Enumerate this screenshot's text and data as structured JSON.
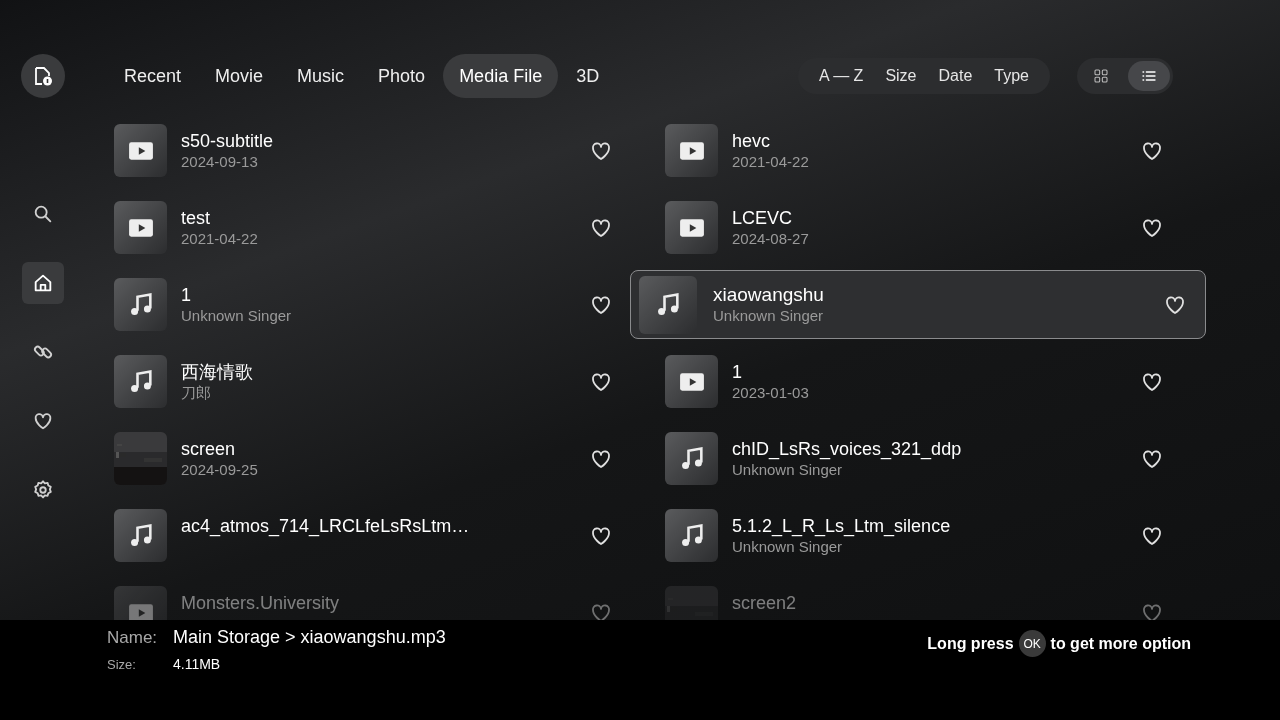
{
  "tabs": [
    {
      "label": "Recent",
      "selected": false
    },
    {
      "label": "Movie",
      "selected": false
    },
    {
      "label": "Music",
      "selected": false
    },
    {
      "label": "Photo",
      "selected": false
    },
    {
      "label": "Media File",
      "selected": true
    },
    {
      "label": "3D",
      "selected": false
    }
  ],
  "sort_options": [
    "A — Z",
    "Size",
    "Date",
    "Type"
  ],
  "view_modes": [
    {
      "kind": "grid",
      "selected": false
    },
    {
      "kind": "list",
      "selected": true
    }
  ],
  "sidebar": {
    "items": [
      {
        "kind": "search",
        "selected": false
      },
      {
        "kind": "home",
        "selected": true
      },
      {
        "kind": "link",
        "selected": false
      },
      {
        "kind": "favorite",
        "selected": false
      },
      {
        "kind": "settings",
        "selected": false
      }
    ]
  },
  "files": [
    {
      "kind": "video",
      "name": "s50-subtitle",
      "detail": "2024-09-13",
      "selected": false
    },
    {
      "kind": "video",
      "name": "hevc",
      "detail": "2021-04-22",
      "selected": false
    },
    {
      "kind": "video",
      "name": "test",
      "detail": "2021-04-22",
      "selected": false
    },
    {
      "kind": "video",
      "name": "LCEVC",
      "detail": "2024-08-27",
      "selected": false
    },
    {
      "kind": "music",
      "name": "1",
      "detail": "Unknown Singer",
      "selected": false
    },
    {
      "kind": "music",
      "name": "xiaowangshu",
      "detail": "Unknown Singer",
      "selected": true
    },
    {
      "kind": "music",
      "name": "西海情歌",
      "detail": "刀郎",
      "selected": false
    },
    {
      "kind": "video",
      "name": "1",
      "detail": "2023-01-03",
      "selected": false
    },
    {
      "kind": "picture",
      "name": "screen",
      "detail": "2024-09-25",
      "selected": false
    },
    {
      "kind": "music",
      "name": "chID_LsRs_voices_321_ddp",
      "detail": "Unknown Singer",
      "selected": false
    },
    {
      "kind": "music",
      "name": "ac4_atmos_714_LRCLfeLsRsLtm…",
      "selected": false
    },
    {
      "kind": "music",
      "name": "5.1.2_L_R_Ls_Ltm_silence",
      "detail": "Unknown Singer",
      "selected": false
    },
    {
      "kind": "video",
      "name": "Monsters.University",
      "selected": false
    },
    {
      "kind": "picture",
      "name": "screen2",
      "selected": false
    }
  ],
  "info": {
    "name_label": "Name:",
    "name_value": "Main Storage > xiaowangshu.mp3",
    "size_label": "Size:",
    "size_value": "4.11MB"
  },
  "hint": {
    "before": "Long press",
    "key": "OK",
    "after": "to get more option"
  }
}
